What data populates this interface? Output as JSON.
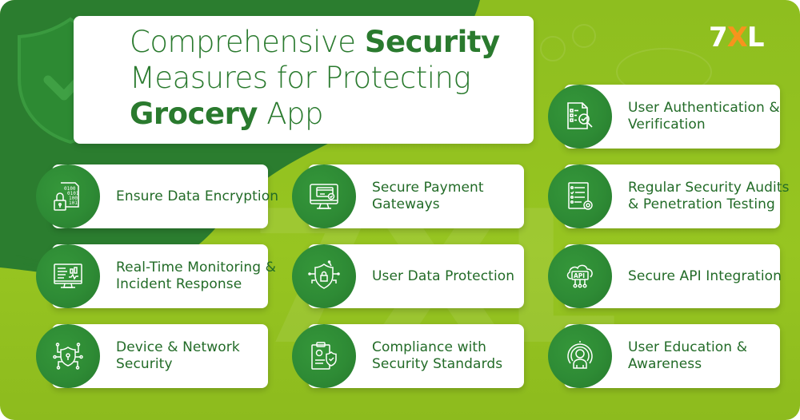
{
  "header": {
    "title_part1_regular": "Comprehensive ",
    "title_part1_bold": "Security",
    "title_line2": "Measures for Protecting",
    "title_part3_bold": "Grocery",
    "title_part3_regular": " App"
  },
  "logo": {
    "text_left": "7",
    "text_accent": "X",
    "text_right": "L"
  },
  "watermark": "7XL",
  "colors": {
    "dark_green": "#2a7a2e",
    "lime_green": "#97c521",
    "accent_orange": "#f7941d",
    "card_bg": "#ffffff"
  },
  "measures": [
    {
      "label": "User Authentication & Verification",
      "icon": "document-search-check-icon"
    },
    {
      "label": "Ensure Data Encryption",
      "icon": "binary-lock-icon"
    },
    {
      "label": "Secure Payment Gateways",
      "icon": "monitor-card-icon"
    },
    {
      "label": "Regular Security Audits & Penetration Testing",
      "icon": "checklist-gear-icon"
    },
    {
      "label": "Real-Time Monitoring & Incident Response",
      "icon": "monitor-chart-icon"
    },
    {
      "label": "User Data Protection",
      "icon": "shield-lock-circuit-icon"
    },
    {
      "label": "Secure API Integration",
      "icon": "cloud-api-icon"
    },
    {
      "label": "Device & Network Security",
      "icon": "shield-keyhole-network-icon"
    },
    {
      "label": "Compliance with Security Standards",
      "icon": "clipboard-shield-icon"
    },
    {
      "label": "User Education & Awareness",
      "icon": "user-broadcast-icon"
    }
  ]
}
